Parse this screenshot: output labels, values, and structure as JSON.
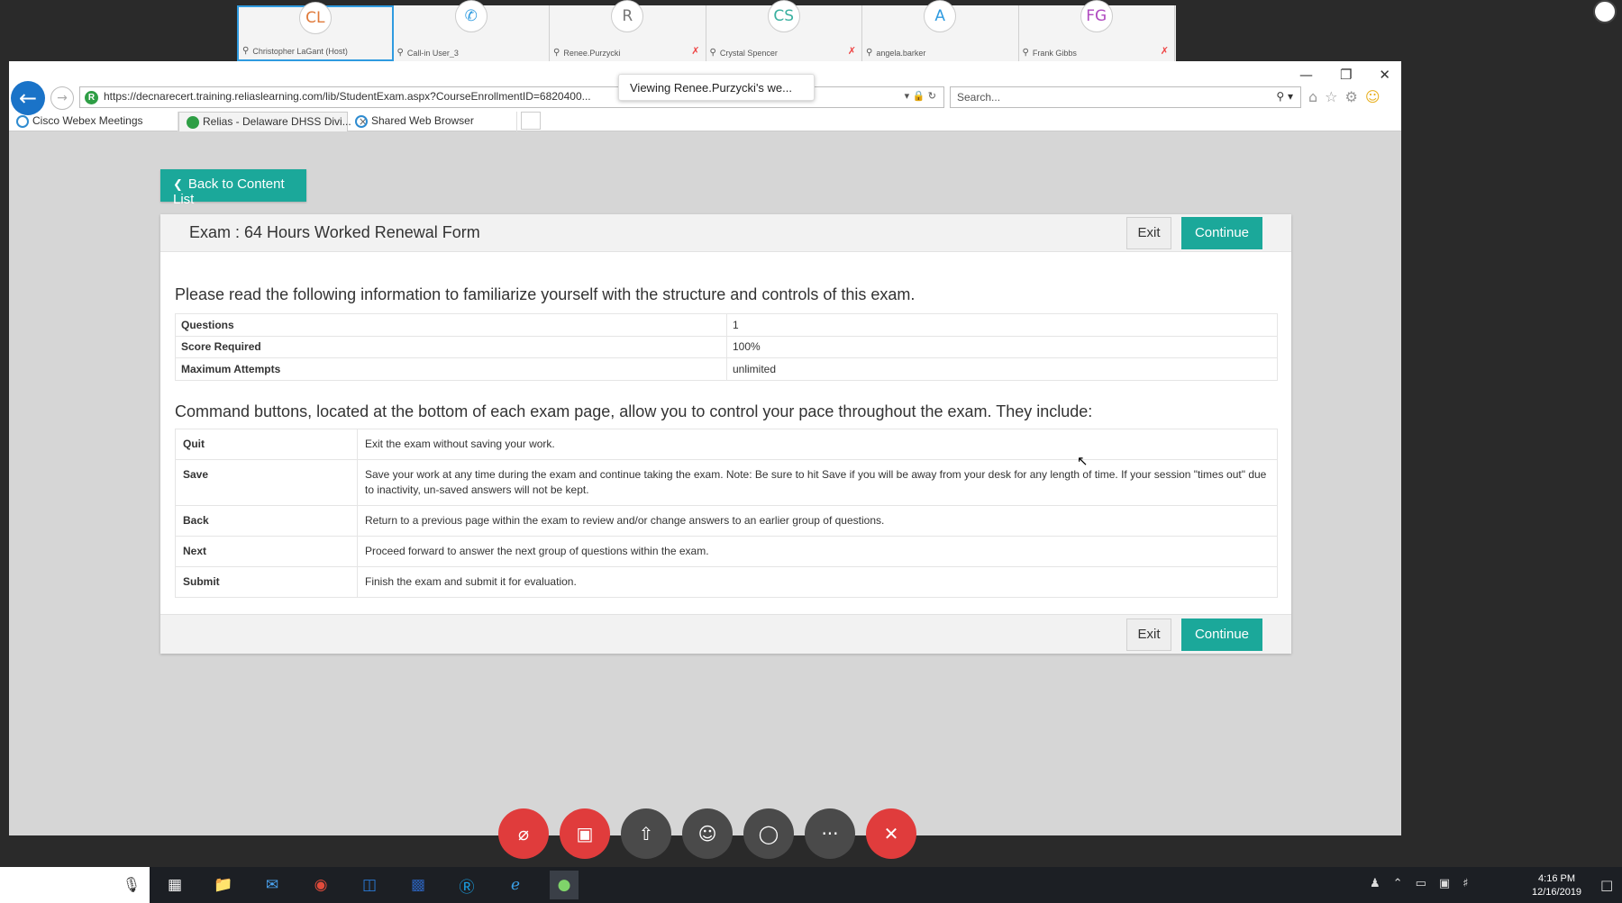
{
  "participants": [
    {
      "initials": "CL",
      "name": "Christopher LaGant (Host)",
      "color": "#e07a3a",
      "muted": false,
      "active": true
    },
    {
      "initials": "✆",
      "name": "Call-in User_3",
      "color": "#2f9be0",
      "muted": false,
      "active": false
    },
    {
      "initials": "R",
      "name": "Renee.Purzycki",
      "color": "#777777",
      "muted": true,
      "active": false
    },
    {
      "initials": "CS",
      "name": "Crystal Spencer",
      "color": "#3ab0a0",
      "muted": true,
      "active": false
    },
    {
      "initials": "A",
      "name": "angela.barker",
      "color": "#2f9be0",
      "muted": false,
      "active": false
    },
    {
      "initials": "FG",
      "name": "Frank Gibbs",
      "color": "#b04ac0",
      "muted": true,
      "active": false
    }
  ],
  "browser": {
    "url": "https://decnarecert.training.reliaslearning.com/lib/StudentExam.aspx?CourseEnrollmentID=6820400...",
    "viewing_tip": "Viewing Renee.Purzycki's we...",
    "search_placeholder": "Search...",
    "tabs": [
      {
        "label": "Cisco Webex Meetings"
      },
      {
        "label": "Relias - Delaware DHSS Divi...",
        "close": "×"
      },
      {
        "label": "Shared Web Browser"
      }
    ]
  },
  "page": {
    "back_label": "Back to Content List",
    "exam_title": "Exam : 64 Hours Worked Renewal Form",
    "exit_label": "Exit",
    "continue_label": "Continue",
    "intro_text": "Please read the following information to familiarize yourself with the structure and controls of this exam.",
    "info_rows": [
      {
        "key": "Questions",
        "value": "1"
      },
      {
        "key": "Score Required",
        "value": "100%"
      },
      {
        "key": "Maximum Attempts",
        "value": "unlimited"
      }
    ],
    "command_intro": "Command buttons, located at the bottom of each exam page, allow you to control your pace throughout the exam. They include:",
    "commands": [
      {
        "key": "Quit",
        "desc": "Exit the exam without saving your work."
      },
      {
        "key": "Save",
        "desc": "Save your work at any time during the exam and continue taking the exam. Note: Be sure to hit Save if you will be away from your desk for any length of time. If your session \"times out\" due to inactivity, un-saved answers will not be kept."
      },
      {
        "key": "Back",
        "desc": "Return to a previous page within the exam to review and/or change answers to an earlier group of questions."
      },
      {
        "key": "Next",
        "desc": "Proceed forward to answer the next group of questions within the exam."
      },
      {
        "key": "Submit",
        "desc": "Finish the exam and submit it for evaluation."
      }
    ]
  },
  "meeting_controls": [
    {
      "name": "mute-button",
      "icon": "mic-off-icon",
      "glyph": "⌀",
      "style": "red"
    },
    {
      "name": "video-button",
      "icon": "video-off-icon",
      "glyph": "▣",
      "style": "red"
    },
    {
      "name": "share-button",
      "icon": "share-icon",
      "glyph": "⇧",
      "style": "gray"
    },
    {
      "name": "participants-button",
      "icon": "participants-icon",
      "glyph": "☺",
      "style": "gray"
    },
    {
      "name": "chat-button",
      "icon": "chat-icon",
      "glyph": "◯",
      "style": "gray"
    },
    {
      "name": "more-button",
      "icon": "more-icon",
      "glyph": "···",
      "style": "gray"
    },
    {
      "name": "end-meeting-button",
      "icon": "close-icon",
      "glyph": "✕",
      "style": "red"
    }
  ],
  "taskbar": {
    "time": "4:16 PM",
    "date": "12/16/2019"
  },
  "colors": {
    "accent_teal": "#1ba89a",
    "end_red": "#e03c3c"
  }
}
